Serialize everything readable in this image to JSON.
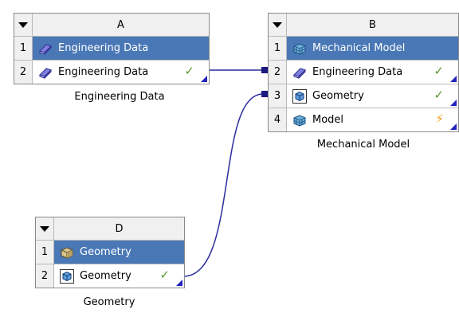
{
  "systems": {
    "a": {
      "letter": "A",
      "caption": "Engineering Data",
      "rows": [
        {
          "num": "1",
          "label": "Engineering Data"
        },
        {
          "num": "2",
          "label": "Engineering Data",
          "status": "✓"
        }
      ]
    },
    "b": {
      "letter": "B",
      "caption": "Mechanical Model",
      "rows": [
        {
          "num": "1",
          "label": "Mechanical Model"
        },
        {
          "num": "2",
          "label": "Engineering Data",
          "status": "✓"
        },
        {
          "num": "3",
          "label": "Geometry",
          "status": "✓"
        },
        {
          "num": "4",
          "label": "Model",
          "status": "⚡"
        }
      ]
    },
    "d": {
      "letter": "D",
      "caption": "Geometry",
      "rows": [
        {
          "num": "1",
          "label": "Geometry"
        },
        {
          "num": "2",
          "label": "Geometry",
          "status": "✓"
        }
      ]
    }
  },
  "colors": {
    "selected_row": "#4a78b6",
    "link_line": "#2c2c9c",
    "check": "#5a9a30",
    "bolt": "#f0a020"
  }
}
